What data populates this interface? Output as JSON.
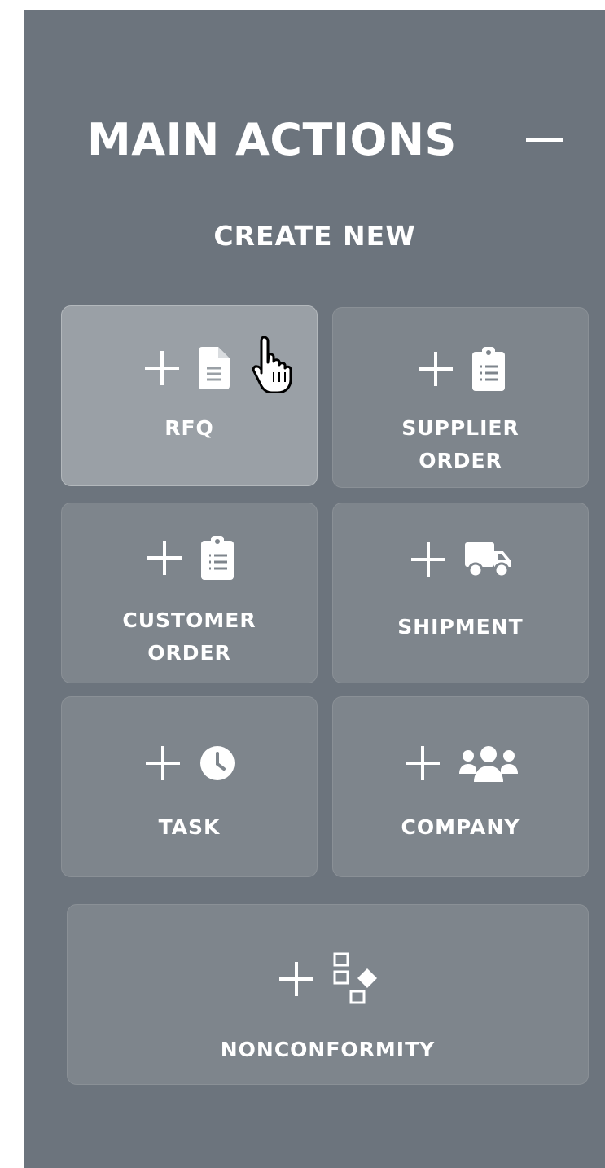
{
  "header": {
    "title": "MAIN ACTIONS",
    "subtitle": "CREATE NEW"
  },
  "colors": {
    "panel": "#6c747d",
    "card": "#7e858c",
    "card_hover": "#9aa0a6",
    "text": "#ffffff"
  },
  "actions": [
    {
      "label": "RFQ",
      "icon": "document-icon"
    },
    {
      "label": "SUPPLIER\nORDER",
      "icon": "clipboard-list-icon"
    },
    {
      "label": "CUSTOMER\nORDER",
      "icon": "clipboard-list-icon"
    },
    {
      "label": "SHIPMENT",
      "icon": "truck-icon"
    },
    {
      "label": "TASK",
      "icon": "clock-icon"
    },
    {
      "label": "COMPANY",
      "icon": "users-icon"
    },
    {
      "label": "NONCONFORMITY",
      "icon": "shapes-icon"
    }
  ]
}
